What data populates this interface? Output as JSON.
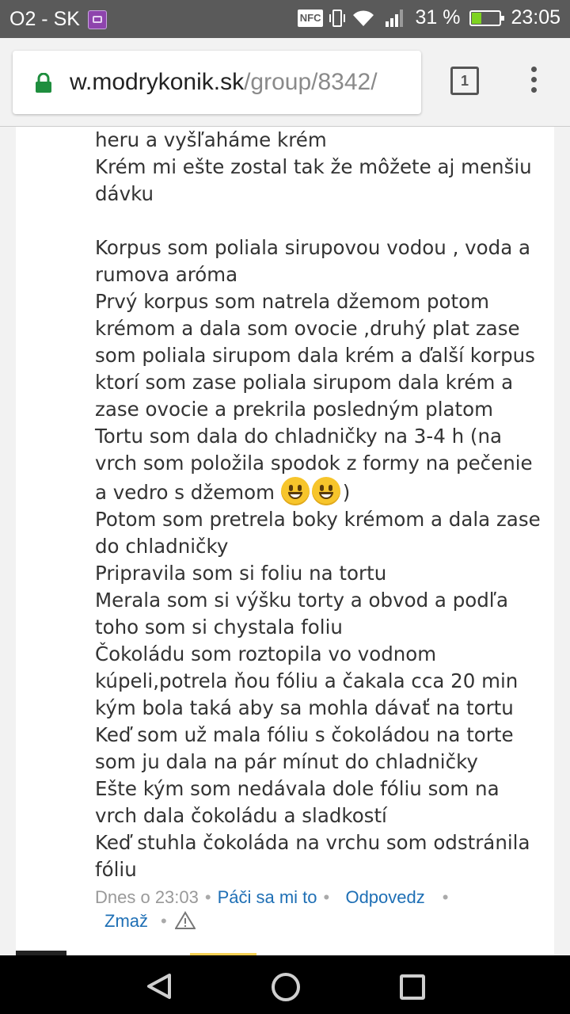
{
  "status_bar": {
    "carrier": "O2 - SK",
    "nfc_label": "NFC",
    "battery_percent": "31 %",
    "battery_level": 0.31,
    "time": "23:05"
  },
  "browser": {
    "url_host": "w.modrykonik.sk",
    "url_path": "/group/8342/",
    "tab_count": "1",
    "lock_color": "#1e8e3e"
  },
  "comment": {
    "lines": [
      "heru a vyšľaháme krém",
      "Krém mi ešte zostal tak že môžete aj menšiu dávku",
      "",
      "Korpus som poliala sirupovou vodou , voda a rumova aróma",
      "Prvý korpus som natrela džemom potom krémom a dala som ovocie ,druhý plat zase som poliala sirupom dala krém a ďalší korpus ktorí som zase poliala sirupom dala krém a zase ovocie a prekrila posledným platom",
      "Tortu som dala do chladničky na 3-4 h (na vrch som položila spodok z formy na pečenie a vedro s džemom",
      "Potom som pretrela boky krémom a dala zase do chladničky",
      "Pripravila som si foliu na tortu",
      "Merala som si výšku torty a obvod a podľa toho som si chystala foliu",
      "Čokoládu som roztopila vo vodnom kúpeli,potrela ňou fóliu a čakala cca 20 min kým bola taká aby sa mohla dávať na tortu",
      "Keď som už mala fóliu s čokoládou na torte som ju dala na pár mínut do chladničky",
      "Ešte kým som nedávala dole fóliu som na vrch dala čokoládu a sladkostí",
      "Keď stuhla čokoláda na vrchu som odstránila fóliu"
    ],
    "emoji_close": ")",
    "emoji_name": "grinning-face",
    "timestamp": "Dnes o 23:03",
    "like_label": "Páči sa mi to",
    "reply_label": "Odpovedz",
    "delete_label": "Zmaž",
    "separator": "•"
  },
  "colors": {
    "link": "#1e6fb5",
    "status_bar_bg": "#5a5a5a",
    "page_bg": "#f2f2f2"
  }
}
